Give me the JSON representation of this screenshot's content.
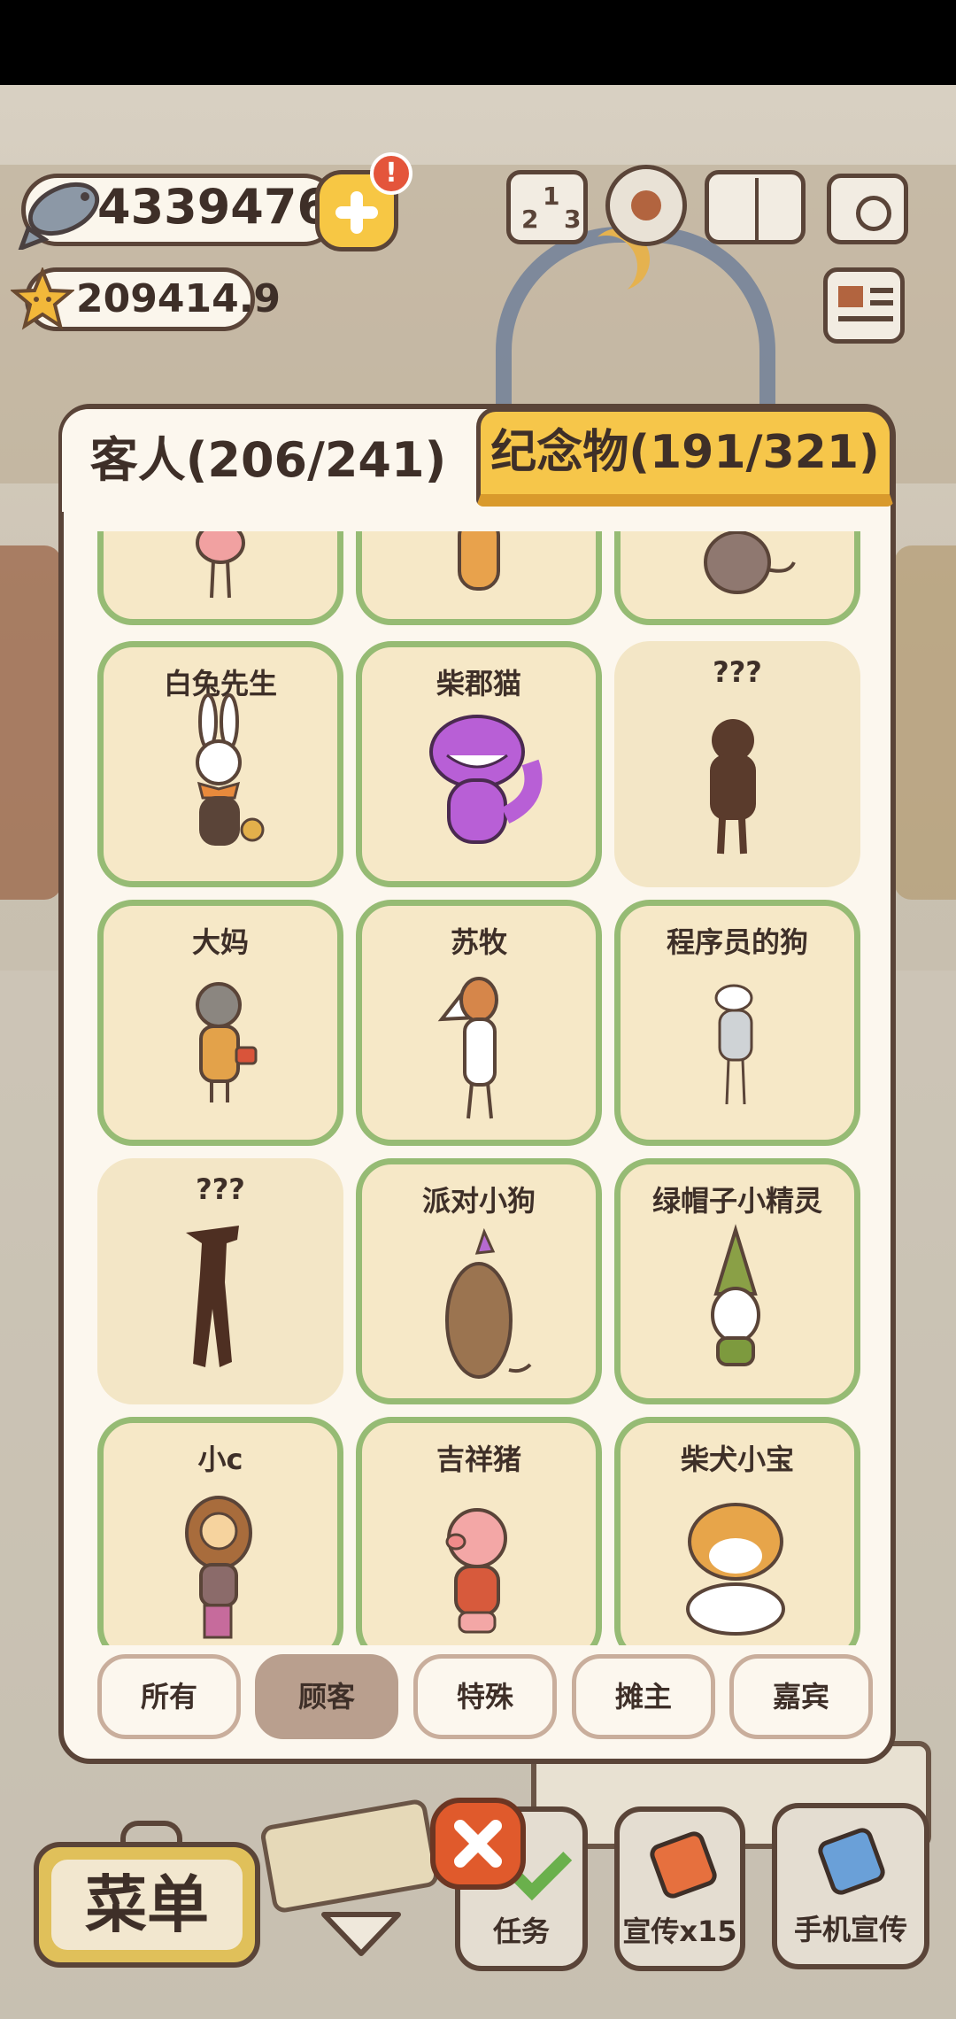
{
  "hud": {
    "fish_count": "4339476",
    "star_count": "209414.9",
    "alert_badge": "!",
    "rank_digits": [
      "2",
      "1",
      "3"
    ]
  },
  "tabs": {
    "guests": "客人(206/241)",
    "souvenirs": "纪念物(191/321)"
  },
  "cards": [
    {
      "name": "",
      "icon": "flamingo"
    },
    {
      "name": "",
      "icon": "fox"
    },
    {
      "name": "",
      "icon": "mouse"
    },
    {
      "name": "白兔先生",
      "icon": "white-rabbit"
    },
    {
      "name": "柴郡猫",
      "icon": "cheshire-cat"
    },
    {
      "name": "???",
      "icon": "unknown-silhouette"
    },
    {
      "name": "大妈",
      "icon": "auntie"
    },
    {
      "name": "苏牧",
      "icon": "collie"
    },
    {
      "name": "程序员的狗",
      "icon": "programmer-dog"
    },
    {
      "name": "???",
      "icon": "unknown-silhouette"
    },
    {
      "name": "派对小狗",
      "icon": "party-dog"
    },
    {
      "name": "绿帽子小精灵",
      "icon": "gnome"
    },
    {
      "name": "小c",
      "icon": "girl"
    },
    {
      "name": "吉祥猪",
      "icon": "lucky-pig"
    },
    {
      "name": "柴犬小宝",
      "icon": "shiba"
    }
  ],
  "filters": [
    {
      "label": "所有",
      "active": false
    },
    {
      "label": "顾客",
      "active": true
    },
    {
      "label": "特殊",
      "active": false
    },
    {
      "label": "摊主",
      "active": false
    },
    {
      "label": "嘉宾",
      "active": false
    }
  ],
  "bottom": {
    "menu": "菜单",
    "task": "任务",
    "promo": "宣传x15",
    "phone_promo": "手机宣传"
  }
}
